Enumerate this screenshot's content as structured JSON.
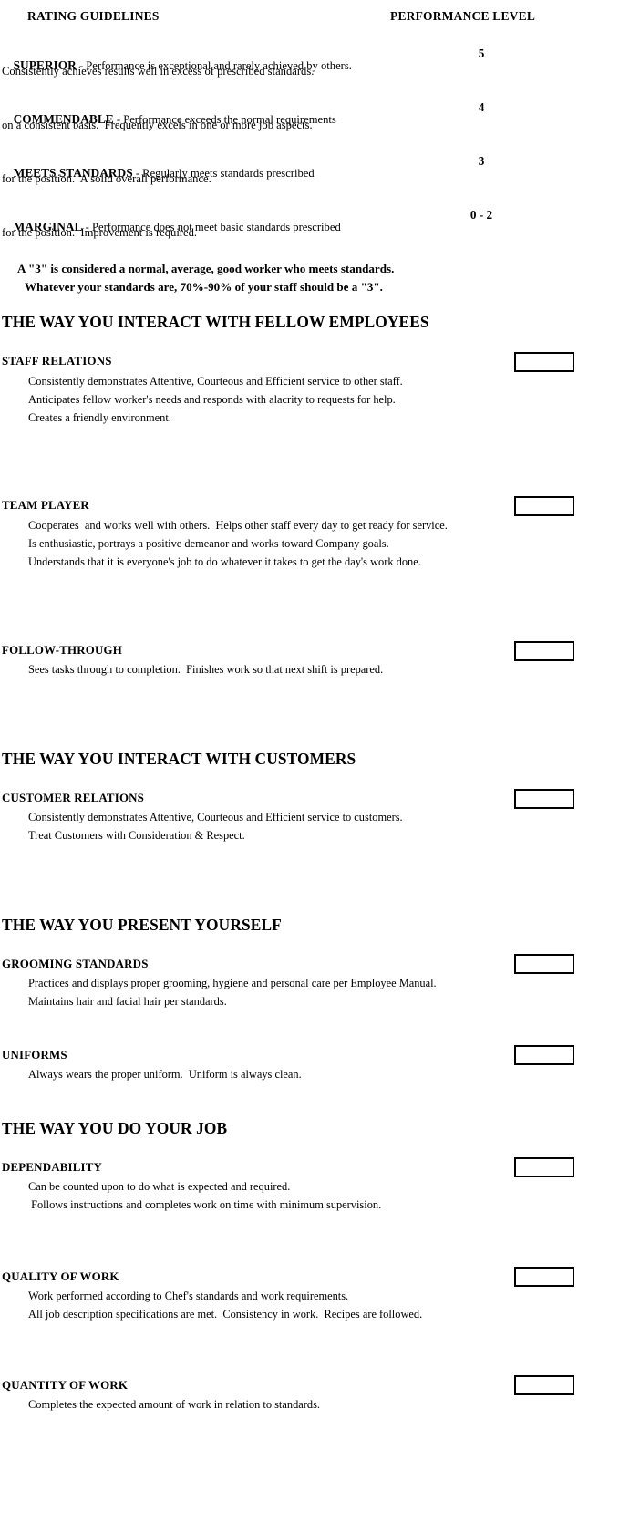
{
  "header": {
    "left_column": "RATING GUIDELINES",
    "right_column": "PERFORMANCE LEVEL"
  },
  "rating_guidelines": [
    {
      "term": "SUPERIOR",
      "line1_rest": " - Performance is exceptional and rarely achieved by others.",
      "line2": "Consistently achieves results well in excess of prescribed standards.",
      "level": "5"
    },
    {
      "term": "COMMENDABLE",
      "line1_rest": " - Performance exceeds the normal requirements",
      "line2": "on a consistent basis.  Frequently excels in one or more job aspects.",
      "level": "4"
    },
    {
      "term": "MEETS STANDARDS",
      "line1_rest": " - Regularly meets standards prescribed",
      "line2": "for the position.  A solid overall performance.",
      "level": "3"
    },
    {
      "term": "MARGINAL",
      "line1_rest": " - Performance does not meet basic standards prescribed",
      "line2": "for the position.  Improvement is required.",
      "level": "0 - 2"
    }
  ],
  "note": {
    "line1": "A \"3\" is considered a normal, average, good worker who meets standards.",
    "line2": "Whatever your standards are, 70%-90% of your staff should be a \"3\"."
  },
  "sections": [
    {
      "banner": "THE WAY YOU INTERACT WITH FELLOW EMPLOYEES",
      "criteria": [
        {
          "heading": "STAFF RELATIONS",
          "lines": [
            "Consistently demonstrates Attentive, Courteous and Efficient service to other staff.",
            "Anticipates fellow worker's needs and responds with alacrity to requests for help.",
            "Creates a friendly environment."
          ],
          "score": ""
        },
        {
          "heading": "TEAM PLAYER",
          "lines": [
            "Cooperates  and works well with others.  Helps other staff every day to get ready for service.",
            "Is enthusiastic, portrays a positive demeanor and works toward Company goals.",
            "Understands that it is everyone's job to do whatever it takes to get the day's work done."
          ],
          "score": ""
        },
        {
          "heading": "FOLLOW-THROUGH",
          "lines": [
            "Sees tasks through to completion.  Finishes work so that next shift is prepared."
          ],
          "score": ""
        }
      ]
    },
    {
      "banner": "THE WAY YOU INTERACT WITH CUSTOMERS",
      "criteria": [
        {
          "heading": "CUSTOMER RELATIONS",
          "lines": [
            "Consistently demonstrates Attentive, Courteous and Efficient service to customers.",
            "Treat Customers with Consideration & Respect."
          ],
          "score": ""
        }
      ]
    },
    {
      "banner": "THE WAY YOU PRESENT YOURSELF",
      "criteria": [
        {
          "heading": "GROOMING STANDARDS",
          "lines": [
            "Practices and displays proper grooming, hygiene and personal care per Employee Manual.",
            "Maintains hair and facial hair per standards."
          ],
          "score": ""
        },
        {
          "heading": "UNIFORMS",
          "lines": [
            "Always wears the proper uniform.  Uniform is always clean."
          ],
          "score": ""
        }
      ]
    },
    {
      "banner": "THE WAY YOU DO YOUR JOB",
      "criteria": [
        {
          "heading": "DEPENDABILITY",
          "lines": [
            "Can be counted upon to do what is expected and required.",
            " Follows instructions and completes work on time with minimum supervision."
          ],
          "score": ""
        },
        {
          "heading": "QUALITY OF WORK",
          "lines": [
            "Work performed according to Chef's standards and work requirements.",
            "All job description specifications are met.  Consistency in work.  Recipes are followed."
          ],
          "score": ""
        },
        {
          "heading": "QUANTITY OF WORK",
          "lines": [
            "Completes the expected amount of work in relation to standards."
          ],
          "score": ""
        }
      ]
    }
  ]
}
